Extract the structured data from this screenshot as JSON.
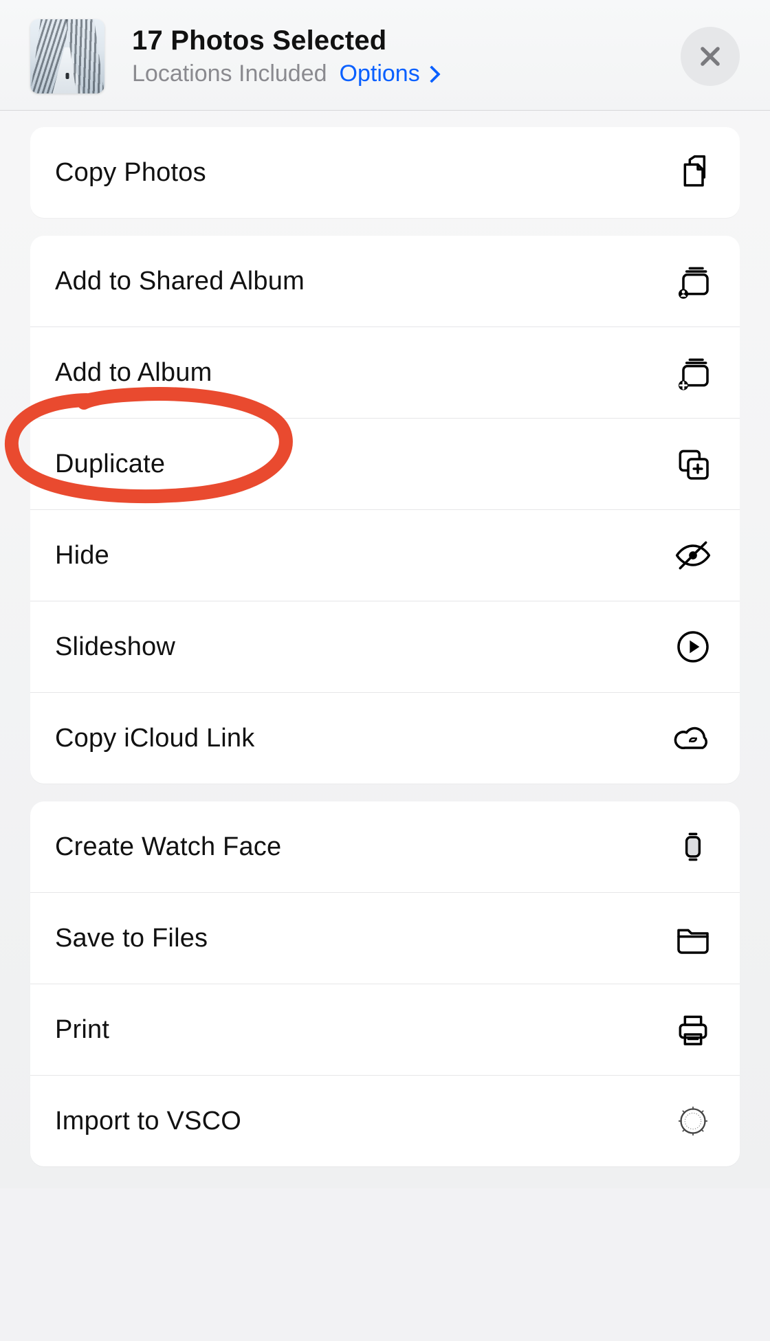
{
  "header": {
    "title": "17 Photos Selected",
    "subtitle": "Locations Included",
    "options_label": "Options"
  },
  "groups": [
    {
      "items": [
        {
          "key": "copy-photos",
          "label": "Copy Photos",
          "icon": "copy-pages-icon"
        }
      ]
    },
    {
      "items": [
        {
          "key": "add-to-shared-album",
          "label": "Add to Shared Album",
          "icon": "shared-album-icon"
        },
        {
          "key": "add-to-album",
          "label": "Add to Album",
          "icon": "add-album-icon"
        },
        {
          "key": "duplicate",
          "label": "Duplicate",
          "icon": "duplicate-plus-icon"
        },
        {
          "key": "hide",
          "label": "Hide",
          "icon": "eye-slash-icon"
        },
        {
          "key": "slideshow",
          "label": "Slideshow",
          "icon": "play-circle-icon"
        },
        {
          "key": "copy-icloud-link",
          "label": "Copy iCloud Link",
          "icon": "cloud-link-icon"
        }
      ]
    },
    {
      "items": [
        {
          "key": "create-watch-face",
          "label": "Create Watch Face",
          "icon": "watch-icon"
        },
        {
          "key": "save-to-files",
          "label": "Save to Files",
          "icon": "folder-icon"
        },
        {
          "key": "print",
          "label": "Print",
          "icon": "printer-icon"
        },
        {
          "key": "import-to-vsco",
          "label": "Import to VSCO",
          "icon": "vsco-icon"
        }
      ]
    }
  ],
  "annotation": {
    "target": "add-to-album",
    "color": "#e94a2f"
  }
}
